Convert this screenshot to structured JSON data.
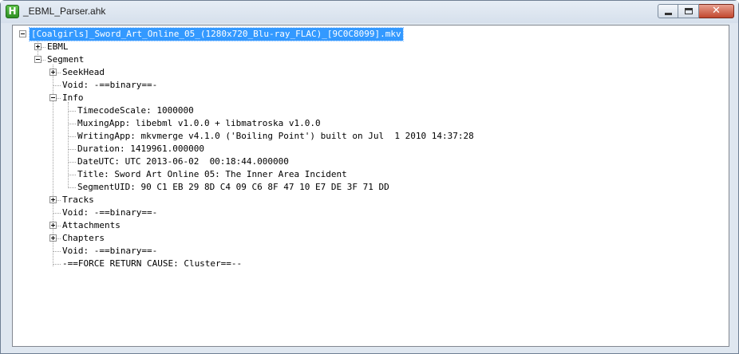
{
  "window": {
    "title": "_EBML_Parser.ahk",
    "icon_letter": "H",
    "icon": "autohotkey-icon",
    "buttons": [
      "minimize",
      "maximize",
      "close"
    ],
    "close_glyph": "✕"
  },
  "tree": {
    "root": "[Coalgirls]_Sword_Art_Online_05_(1280x720_Blu-ray_FLAC)_[9C0C8099].mkv",
    "ebml": "EBML",
    "segment": "Segment",
    "seekhead": "SeekHead",
    "void1": "Void: -==binary==-",
    "info": "Info",
    "info_items": {
      "timecode_scale": "TimecodeScale: 1000000",
      "muxing_app": "MuxingApp: libebml v1.0.0 + libmatroska v1.0.0",
      "writing_app": "WritingApp: mkvmerge v4.1.0 ('Boiling Point') built on Jul  1 2010 14:37:28",
      "duration": "Duration: 1419961.000000",
      "date_utc": "DateUTC: UTC 2013-06-02  00:18:44.000000",
      "title": "Title: Sword Art Online 05: The Inner Area Incident",
      "segment_uid": "SegmentUID: 90 C1 EB 29 8D C4 09 C6 8F 47 10 E7 DE 3F 71 DD"
    },
    "tracks": "Tracks",
    "void2": "Void: -==binary==-",
    "attachments": "Attachments",
    "chapters": "Chapters",
    "void3": "Void: -==binary==-",
    "force_return": "-==FORCE RETURN CAUSE: Cluster==--"
  }
}
